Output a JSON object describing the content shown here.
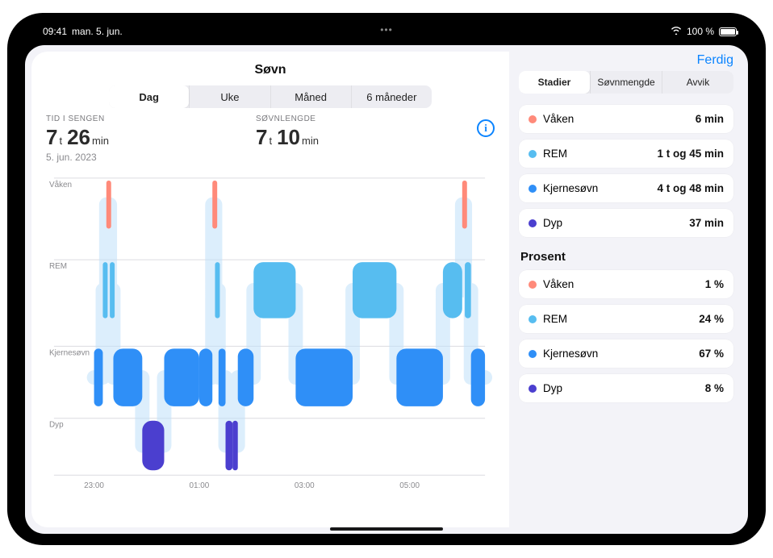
{
  "status_bar": {
    "time": "09:41",
    "date": "man. 5. jun.",
    "battery": "100 %"
  },
  "header": {
    "title": "Søvn",
    "done": "Ferdig"
  },
  "range_tabs": {
    "items": [
      "Dag",
      "Uke",
      "Måned",
      "6 måneder"
    ],
    "active": 0
  },
  "metrics": {
    "inbed": {
      "label": "TID I SENGEN",
      "hours": "7",
      "h_unit": "t",
      "mins": "26",
      "m_unit": "min"
    },
    "asleep": {
      "label": "SØVNLENGDE",
      "hours": "7",
      "h_unit": "t",
      "mins": "10",
      "m_unit": "min"
    },
    "date": "5. jun. 2023"
  },
  "sidebar_tabs": {
    "items": [
      "Stadier",
      "Søvnmengde",
      "Avvik"
    ],
    "active": 0
  },
  "stage_labels": {
    "awake": "Våken",
    "rem": "REM",
    "core": "Kjernesøvn",
    "deep": "Dyp"
  },
  "stage_colors": {
    "awake": "#ff8a7a",
    "rem": "#57bdf0",
    "core": "#2f8ff7",
    "deep": "#4b3fcf"
  },
  "durations": [
    {
      "stage": "awake",
      "value": "6 min"
    },
    {
      "stage": "rem",
      "value": "1 t og 45 min"
    },
    {
      "stage": "core",
      "value": "4 t og 48 min"
    },
    {
      "stage": "deep",
      "value": "37 min"
    }
  ],
  "percent_title": "Prosent",
  "percents": [
    {
      "stage": "awake",
      "value": "1 %"
    },
    {
      "stage": "rem",
      "value": "24 %"
    },
    {
      "stage": "core",
      "value": "67 %"
    },
    {
      "stage": "deep",
      "value": "8 %"
    }
  ],
  "chart_data": {
    "type": "hypnogram",
    "title": "Søvn",
    "x_ticks": [
      "23:00",
      "01:00",
      "03:00",
      "05:00"
    ],
    "stages_y": [
      "Våken",
      "REM",
      "Kjernesøvn",
      "Dyp"
    ],
    "stage_durations_min": {
      "Våken": 6,
      "REM": 105,
      "Kjernesøvn": 288,
      "Dyp": 37
    },
    "stage_percent": {
      "Våken": 1,
      "REM": 24,
      "Kjernesøvn": 67,
      "Dyp": 8
    },
    "time_in_bed_min": 446,
    "time_asleep_min": 430,
    "x_range": [
      "23:00",
      "06:26"
    ],
    "segments": [
      {
        "start_min": 0,
        "end_min": 10,
        "stage": "Kjernesøvn"
      },
      {
        "start_min": 10,
        "end_min": 14,
        "stage": "REM"
      },
      {
        "start_min": 14,
        "end_min": 18,
        "stage": "Våken"
      },
      {
        "start_min": 18,
        "end_min": 22,
        "stage": "REM"
      },
      {
        "start_min": 22,
        "end_min": 55,
        "stage": "Kjernesøvn"
      },
      {
        "start_min": 55,
        "end_min": 80,
        "stage": "Dyp"
      },
      {
        "start_min": 80,
        "end_min": 120,
        "stage": "Kjernesøvn"
      },
      {
        "start_min": 120,
        "end_min": 135,
        "stage": "Kjernesøvn"
      },
      {
        "start_min": 135,
        "end_min": 138,
        "stage": "Våken"
      },
      {
        "start_min": 138,
        "end_min": 142,
        "stage": "REM"
      },
      {
        "start_min": 142,
        "end_min": 150,
        "stage": "Kjernesøvn"
      },
      {
        "start_min": 150,
        "end_min": 158,
        "stage": "Dyp"
      },
      {
        "start_min": 158,
        "end_min": 164,
        "stage": "Dyp"
      },
      {
        "start_min": 164,
        "end_min": 182,
        "stage": "Kjernesøvn"
      },
      {
        "start_min": 182,
        "end_min": 230,
        "stage": "REM"
      },
      {
        "start_min": 230,
        "end_min": 295,
        "stage": "Kjernesøvn"
      },
      {
        "start_min": 295,
        "end_min": 345,
        "stage": "REM"
      },
      {
        "start_min": 345,
        "end_min": 398,
        "stage": "Kjernesøvn"
      },
      {
        "start_min": 398,
        "end_min": 420,
        "stage": "REM"
      },
      {
        "start_min": 420,
        "end_min": 423,
        "stage": "Våken"
      },
      {
        "start_min": 423,
        "end_min": 430,
        "stage": "REM"
      },
      {
        "start_min": 430,
        "end_min": 446,
        "stage": "Kjernesøvn"
      }
    ]
  }
}
